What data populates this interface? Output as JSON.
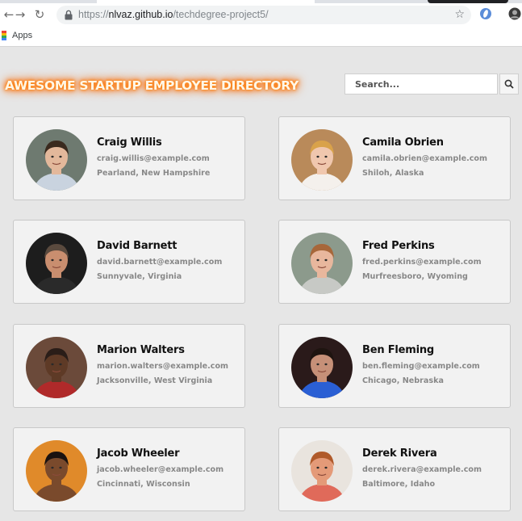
{
  "browser": {
    "url_scheme": "https://",
    "url_host": "nlvaz.github.io",
    "url_path": "/techdegree-project5/",
    "bookmarks": [
      {
        "label": "Apps"
      }
    ]
  },
  "header": {
    "title": "AWESOME STARTUP EMPLOYEE DIRECTORY",
    "search_placeholder": "Search..."
  },
  "employees": [
    {
      "name": "Craig Willis",
      "email": "craig.willis@example.com",
      "location": "Pearland, New Hampshire",
      "photo": {
        "bg": "#6e7a70",
        "skin": "#e3b89b",
        "hair": "#3a2a1e",
        "shirt": "#c9d3df"
      }
    },
    {
      "name": "Camila Obrien",
      "email": "camila.obrien@example.com",
      "location": "Shiloh, Alaska",
      "photo": {
        "bg": "#b98a5a",
        "skin": "#f0c7ae",
        "hair": "#d9a24a",
        "shirt": "#f4f0ec"
      }
    },
    {
      "name": "David Barnett",
      "email": "david.barnett@example.com",
      "location": "Sunnyvale, Virginia",
      "photo": {
        "bg": "#1d1d1d",
        "skin": "#c98e6f",
        "hair": "#5a4a3e",
        "shirt": "#2a2a2a"
      }
    },
    {
      "name": "Fred Perkins",
      "email": "fred.perkins@example.com",
      "location": "Murfreesboro, Wyoming",
      "photo": {
        "bg": "#8c9a8c",
        "skin": "#e8b79d",
        "hair": "#a7673a",
        "shirt": "#c7c9c5"
      }
    },
    {
      "name": "Marion Walters",
      "email": "marion.walters@example.com",
      "location": "Jacksonville, West Virginia",
      "photo": {
        "bg": "#6b4a3a",
        "skin": "#5e3a26",
        "hair": "#2a1d18",
        "shirt": "#b02a2a"
      }
    },
    {
      "name": "Ben Fleming",
      "email": "ben.fleming@example.com",
      "location": "Chicago, Nebraska",
      "photo": {
        "bg": "#2a1a1a",
        "skin": "#c69078",
        "hair": "#1e1410",
        "shirt": "#2a5fd4"
      }
    },
    {
      "name": "Jacob Wheeler",
      "email": "jacob.wheeler@example.com",
      "location": "Cincinnati, Wisconsin",
      "photo": {
        "bg": "#e08a2a",
        "skin": "#7a4a2c",
        "hair": "#1a1210",
        "shirt": "#7a4a2c"
      }
    },
    {
      "name": "Derek Rivera",
      "email": "derek.rivera@example.com",
      "location": "Baltimore, Idaho",
      "photo": {
        "bg": "#e9e4de",
        "skin": "#e49a78",
        "hair": "#b05a2a",
        "shirt": "#e06a5a"
      }
    }
  ]
}
